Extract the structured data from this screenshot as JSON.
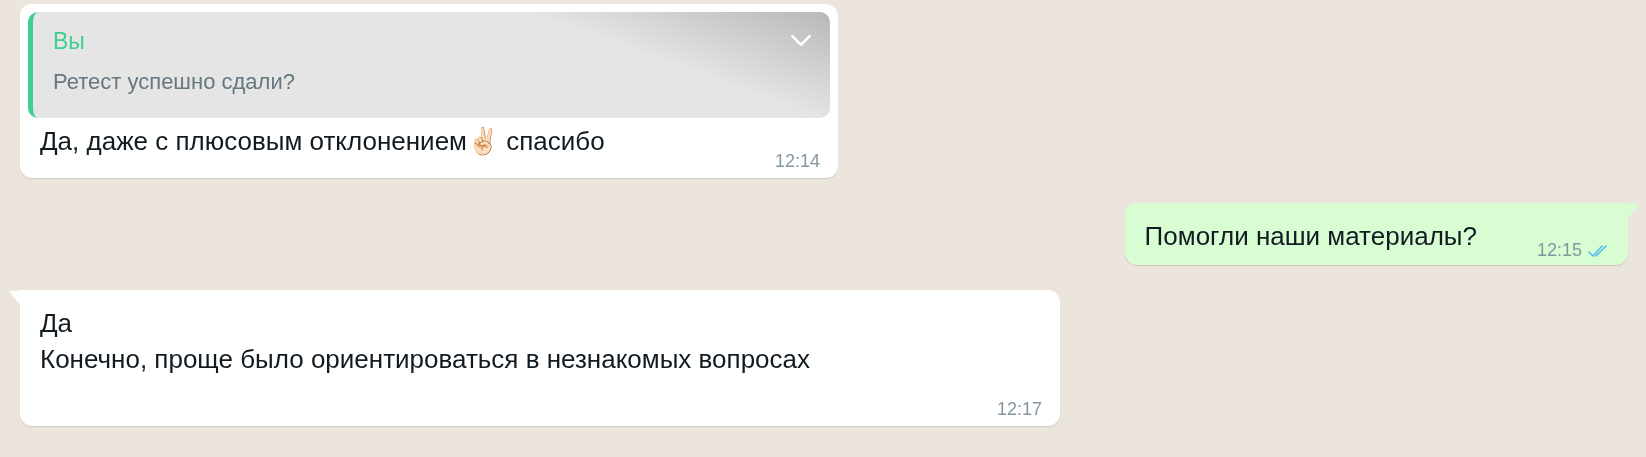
{
  "messages": [
    {
      "kind": "incoming",
      "tail": false,
      "quote": {
        "author": "Вы",
        "text": "Ретест успешно сдали?"
      },
      "lines": [
        "Да, даже с плюсовым отклонением✌🏻 спасибо"
      ],
      "time": "12:14"
    },
    {
      "kind": "outgoing",
      "tail": true,
      "lines": [
        "Помогли наши материалы?"
      ],
      "time": "12:15",
      "read": true
    },
    {
      "kind": "incoming",
      "tail": true,
      "lines": [
        "Да",
        "Конечно, проще было ориентироваться в незнакомых вопросах"
      ],
      "time": "12:17"
    }
  ]
}
